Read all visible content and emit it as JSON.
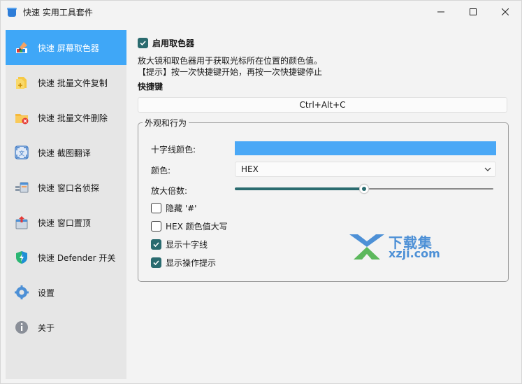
{
  "window": {
    "title": "快速 实用工具套件",
    "controls": {
      "minimize": "minimize-icon",
      "maximize": "maximize-icon",
      "close": "close-icon"
    }
  },
  "sidebar": {
    "items": [
      {
        "label": "快速 屏幕取色器",
        "icon": "color-picker-icon",
        "active": true
      },
      {
        "label": "快速 批量文件复制",
        "icon": "file-copy-icon",
        "active": false
      },
      {
        "label": "快速 批量文件删除",
        "icon": "file-delete-icon",
        "active": false
      },
      {
        "label": "快速 截图翻译",
        "icon": "screenshot-translate-icon",
        "active": false
      },
      {
        "label": "快速 窗口名侦探",
        "icon": "window-detective-icon",
        "active": false
      },
      {
        "label": "快速 窗口置顶",
        "icon": "window-pin-icon",
        "active": false
      },
      {
        "label": "快速 Defender 开关",
        "icon": "defender-shield-icon",
        "active": false
      },
      {
        "label": "设置",
        "icon": "settings-gear-icon",
        "active": false
      },
      {
        "label": "关于",
        "icon": "info-icon",
        "active": false
      }
    ]
  },
  "main": {
    "enable_label": "启用取色器",
    "enable_checked": true,
    "description": "放大镜和取色器用于获取光标所在位置的颜色值。",
    "tip": "【提示】按一次快捷键开始，再按一次快捷键停止",
    "hotkey_heading": "快捷键",
    "hotkey_value": "Ctrl+Alt+C",
    "appearance": {
      "legend": "外观和行为",
      "crosshair_color_label": "十字线颜色:",
      "crosshair_color": "#4aa8f6",
      "color_label": "颜色:",
      "color_format": "HEX",
      "zoom_label": "放大倍数:",
      "zoom_level": 0.5,
      "options": [
        {
          "label": "隐藏 '#'",
          "checked": false
        },
        {
          "label": "HEX 颜色值大写",
          "checked": false
        },
        {
          "label": "显示十字线",
          "checked": true
        },
        {
          "label": "显示操作提示",
          "checked": true
        }
      ]
    }
  },
  "watermark": {
    "text1": "下载集",
    "text2": "xzji.com"
  },
  "colors": {
    "accent": "#3fa7f7",
    "checkbox": "#2a6b6f"
  }
}
